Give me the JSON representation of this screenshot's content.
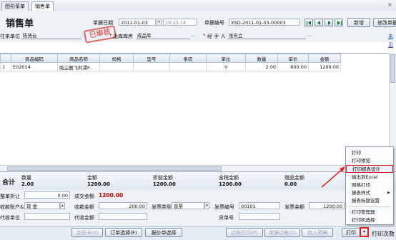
{
  "tabs": [
    {
      "label": "图形菜单"
    },
    {
      "label": "销售单"
    }
  ],
  "header": {
    "title": "销售单",
    "date_label": "单据日期",
    "date_value": "2011-01-03",
    "time_value": "19:25:18",
    "docno_label": "单据编号",
    "docno_value": "XSD-2011-01-03-00003",
    "new_btn": "新增",
    "modify_btn": "修改单据",
    "partner_label": "往来单位",
    "partner_value": "陈贤云",
    "warehouse_label": "出库库房",
    "warehouse_value": "成品库",
    "handler_label": "经 手 人",
    "handler_value": "张东立",
    "stamp": "已审核",
    "side_link1": "未",
    "side_link2": "见"
  },
  "grid": {
    "columns": [
      "商品编码",
      "商品名称",
      "规格",
      "型号",
      "条码",
      "单位",
      "数量",
      "单价",
      "金额"
    ],
    "rows": [
      {
        "idx": "1",
        "code": "E02014",
        "name": "吸尘器飞利浦F...",
        "spec": "",
        "model": "",
        "barcode": "",
        "unit": "个",
        "qty": "2.00",
        "price": "600.00",
        "amount": "1200.00"
      }
    ]
  },
  "totals": {
    "label": "合计",
    "qty_label": "数量",
    "qty_value": "2.00",
    "amount_label": "金额",
    "amount_value": "1200.00",
    "disc_label": "折前金额",
    "disc_value": "1200.00",
    "tax_label": "含税金额",
    "tax_value": "1200.00",
    "gift_label": "赠品金额",
    "gift_value": "0.00"
  },
  "footer": {
    "whole_disc_label": "整单折让",
    "whole_disc_value": "0.00",
    "deal_amount_label": "成交金额",
    "deal_amount_value": "1200.00",
    "account_label": "收款账户&",
    "account_value": "现  金",
    "recv_label": "收款金额",
    "recv_value": "200.00",
    "invoice_type_label": "发票类型",
    "invoice_type_value": "普票",
    "invoice_no_label": "发票编号",
    "invoice_no_value": "00101",
    "invoice_amount_label": "发票金额",
    "invoice_amount_value": "1200.00",
    "agent_label": "代收单位",
    "agent_amount_label": "代收金额",
    "bill_no_label": "货单号"
  },
  "bottom": {
    "member_btn": "会员卡(Y)",
    "order_btn": "订单选择(F)",
    "quote_btn": "报价单选择",
    "post_print_btn": "过帐打印(P)",
    "post_btn": "单据过帐(S)",
    "draft_btn": "存入草稿",
    "print_btn": "打印",
    "print_count_label": "打印次数"
  },
  "menu": {
    "items": [
      "打印",
      "打印预览",
      "打印报表设计",
      "输出到Excel",
      "网格打印",
      "报表样式",
      "报表标题设置",
      "打印管理器",
      "打印机选择"
    ],
    "highlighted": "打印报表设计"
  },
  "colors": {
    "stamp": "#d9534f",
    "highlight_border": "#e02020",
    "header_bg": "#eef2f7"
  }
}
